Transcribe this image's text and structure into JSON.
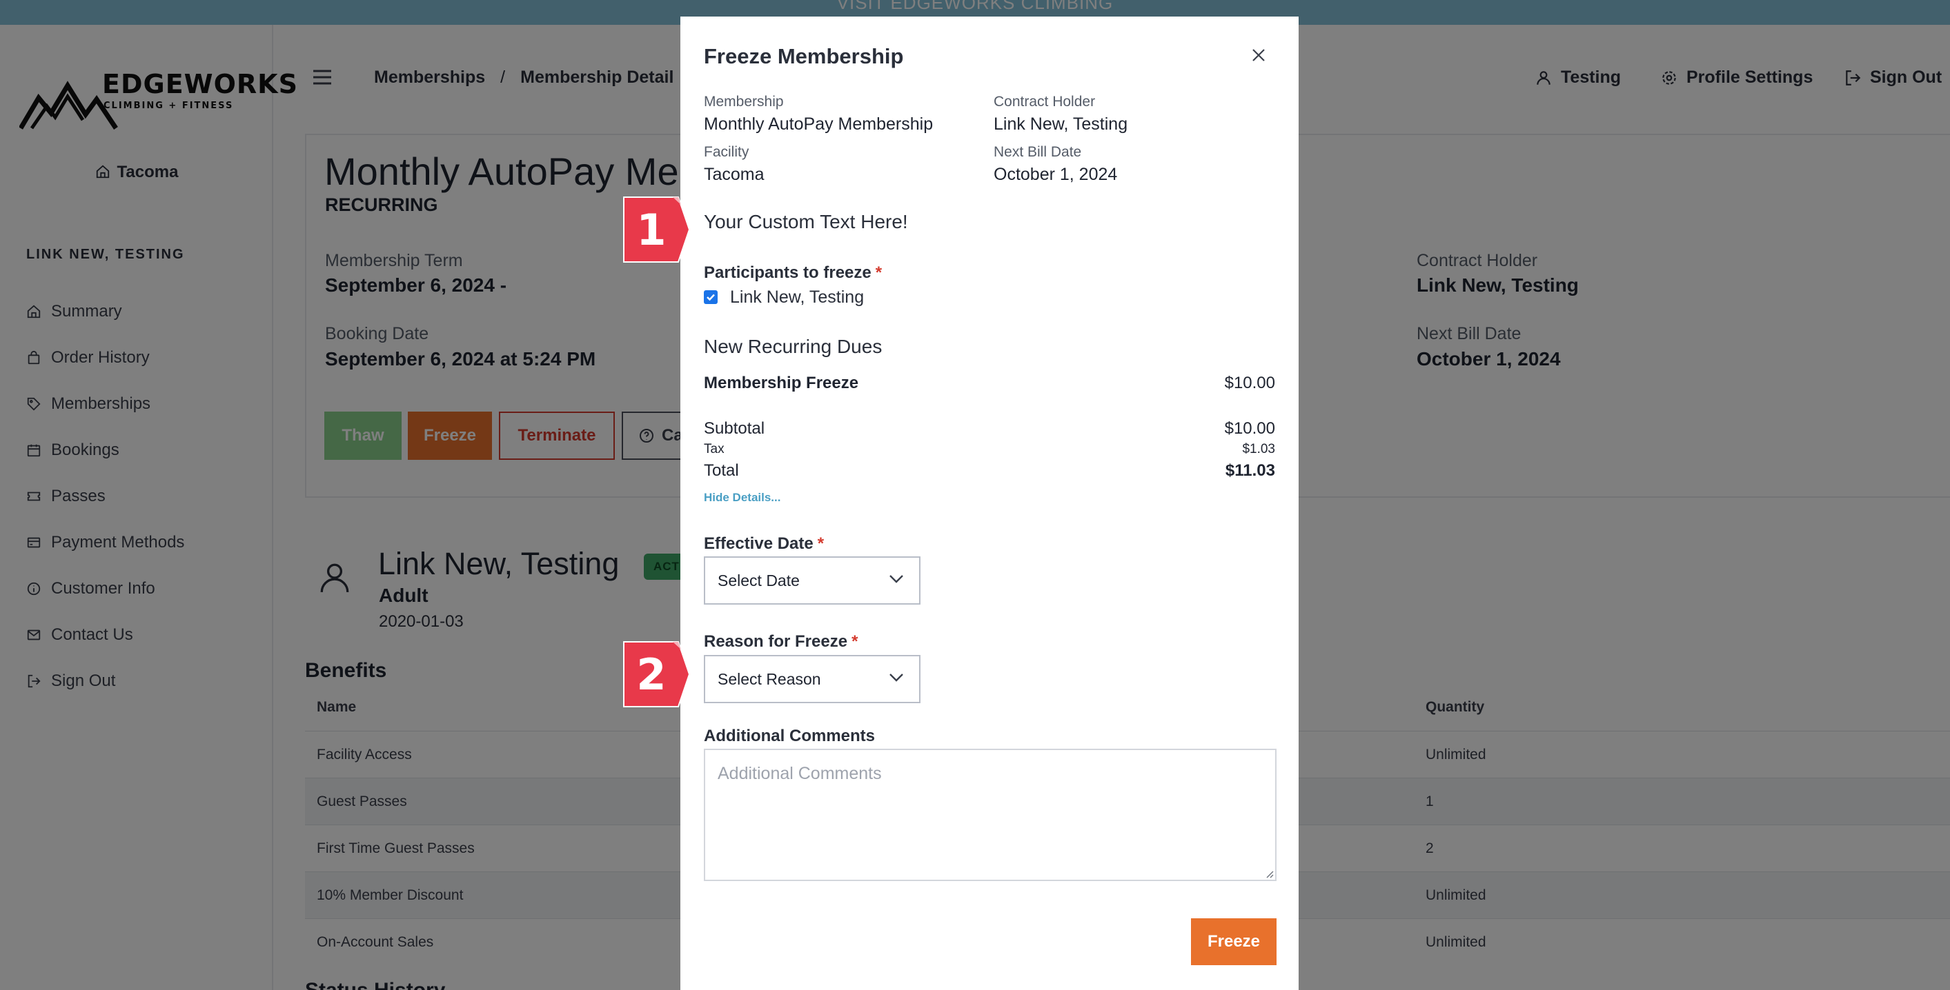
{
  "banner": {
    "text": "VISIT EDGEWORKS CLIMBING"
  },
  "brand": {
    "name": "EDGEWORKS",
    "tagline": "CLIMBING + FITNESS"
  },
  "sidebar": {
    "location": "Tacoma",
    "user_heading": "LINK NEW, TESTING",
    "items": [
      {
        "label": "Summary",
        "icon": "home-icon"
      },
      {
        "label": "Order History",
        "icon": "bag-icon"
      },
      {
        "label": "Memberships",
        "icon": "tag-icon"
      },
      {
        "label": "Bookings",
        "icon": "calendar-icon"
      },
      {
        "label": "Passes",
        "icon": "ticket-icon"
      },
      {
        "label": "Payment Methods",
        "icon": "card-icon"
      },
      {
        "label": "Customer Info",
        "icon": "info-icon"
      },
      {
        "label": "Contact Us",
        "icon": "mail-icon"
      },
      {
        "label": "Sign Out",
        "icon": "sign-out-icon"
      }
    ]
  },
  "header": {
    "breadcrumb": [
      "Memberships",
      "Membership Detail"
    ],
    "separator": "/",
    "user": "Testing",
    "profile_settings": "Profile Settings",
    "sign_out": "Sign Out"
  },
  "membership": {
    "title": "Monthly AutoPay Membership",
    "type": "RECURRING",
    "term_label": "Membership Term",
    "term_value": "September 6, 2024 -",
    "booking_label": "Booking Date",
    "booking_value": "September 6, 2024 at 5:24 PM",
    "holder_label": "Contract Holder",
    "holder_value": "Link New, Testing",
    "next_bill_label": "Next Bill Date",
    "next_bill_value": "October 1, 2024",
    "buttons": {
      "thaw": "Thaw",
      "freeze": "Freeze",
      "terminate": "Terminate",
      "cancel": "Ca"
    }
  },
  "participant": {
    "name": "Link New, Testing",
    "status": "ACTIVE",
    "age_group": "Adult",
    "dob": "2020-01-03"
  },
  "benefits": {
    "title": "Benefits",
    "columns": [
      "Name",
      "Quantity"
    ],
    "rows": [
      {
        "name": "Facility Access",
        "quantity": "Unlimited"
      },
      {
        "name": "Guest Passes",
        "quantity": "1"
      },
      {
        "name": "First Time Guest Passes",
        "quantity": "2"
      },
      {
        "name": "10% Member Discount",
        "quantity": "Unlimited"
      },
      {
        "name": "On-Account Sales",
        "quantity": "Unlimited"
      }
    ]
  },
  "status_history_title": "Status History",
  "modal": {
    "title": "Freeze Membership",
    "membership_label": "Membership",
    "membership_value": "Monthly AutoPay Membership",
    "holder_label": "Contract Holder",
    "holder_value": "Link New, Testing",
    "facility_label": "Facility",
    "facility_value": "Tacoma",
    "next_bill_label": "Next Bill Date",
    "next_bill_value": "October 1, 2024",
    "custom_text": "Your Custom Text Here!",
    "participants_label": "Participants to freeze",
    "required_mark": "*",
    "participant_option": "Link New, Testing",
    "participant_checked": true,
    "dues_title": "New Recurring Dues",
    "line_item": {
      "name": "Membership Freeze",
      "amount": "$10.00"
    },
    "subtotal_label": "Subtotal",
    "subtotal_value": "$10.00",
    "tax_label": "Tax",
    "tax_value": "$1.03",
    "total_label": "Total",
    "total_value": "$11.03",
    "hide_details": "Hide Details...",
    "effective_date_label": "Effective Date",
    "effective_date_value": "Select Date",
    "reason_label": "Reason for Freeze",
    "reason_value": "Select Reason",
    "comments_label": "Additional Comments",
    "comments_placeholder": "Additional Comments",
    "submit": "Freeze"
  },
  "callouts": [
    "1",
    "2"
  ],
  "colors": {
    "banner": "#84c1d8",
    "freeze_orange": "#e8712c",
    "thaw_green": "#8bd08c",
    "terminate_red": "#d43b2e",
    "callout_red": "#e8394a",
    "link_blue": "#4a9fc4"
  }
}
